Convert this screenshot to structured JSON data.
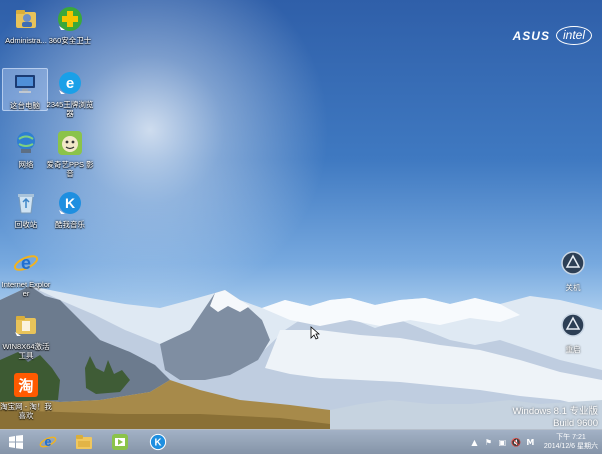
{
  "brand": {
    "asus": "ASUS",
    "intel": "intel"
  },
  "desktop_icons": [
    {
      "label": "Administra..."
    },
    {
      "label": "360安全卫士"
    },
    {
      "label": "这台电脑"
    },
    {
      "label": "2345王牌浏览器"
    },
    {
      "label": "网络"
    },
    {
      "label": "爱奇艺PPS 影音"
    },
    {
      "label": "回收站"
    },
    {
      "label": "酷我音乐"
    },
    {
      "label": "Internet Explorer"
    },
    {
      "label": "WIN8X64激活工具"
    },
    {
      "label": "淘宝网 - 淘！我喜欢"
    }
  ],
  "right_buttons": [
    {
      "label": "关机"
    },
    {
      "label": "重启"
    }
  ],
  "watermark": {
    "line1": "Windows 8.1 专业版",
    "line2": "Build 9600"
  },
  "taskbar": {
    "clock_time": "下午 7:21",
    "clock_date": "2014/12/6 星期六"
  },
  "colors": {
    "taskbar": "#8c9bb0",
    "sky_top": "#2f5fa9",
    "sky_bottom": "#d9ebfb"
  }
}
